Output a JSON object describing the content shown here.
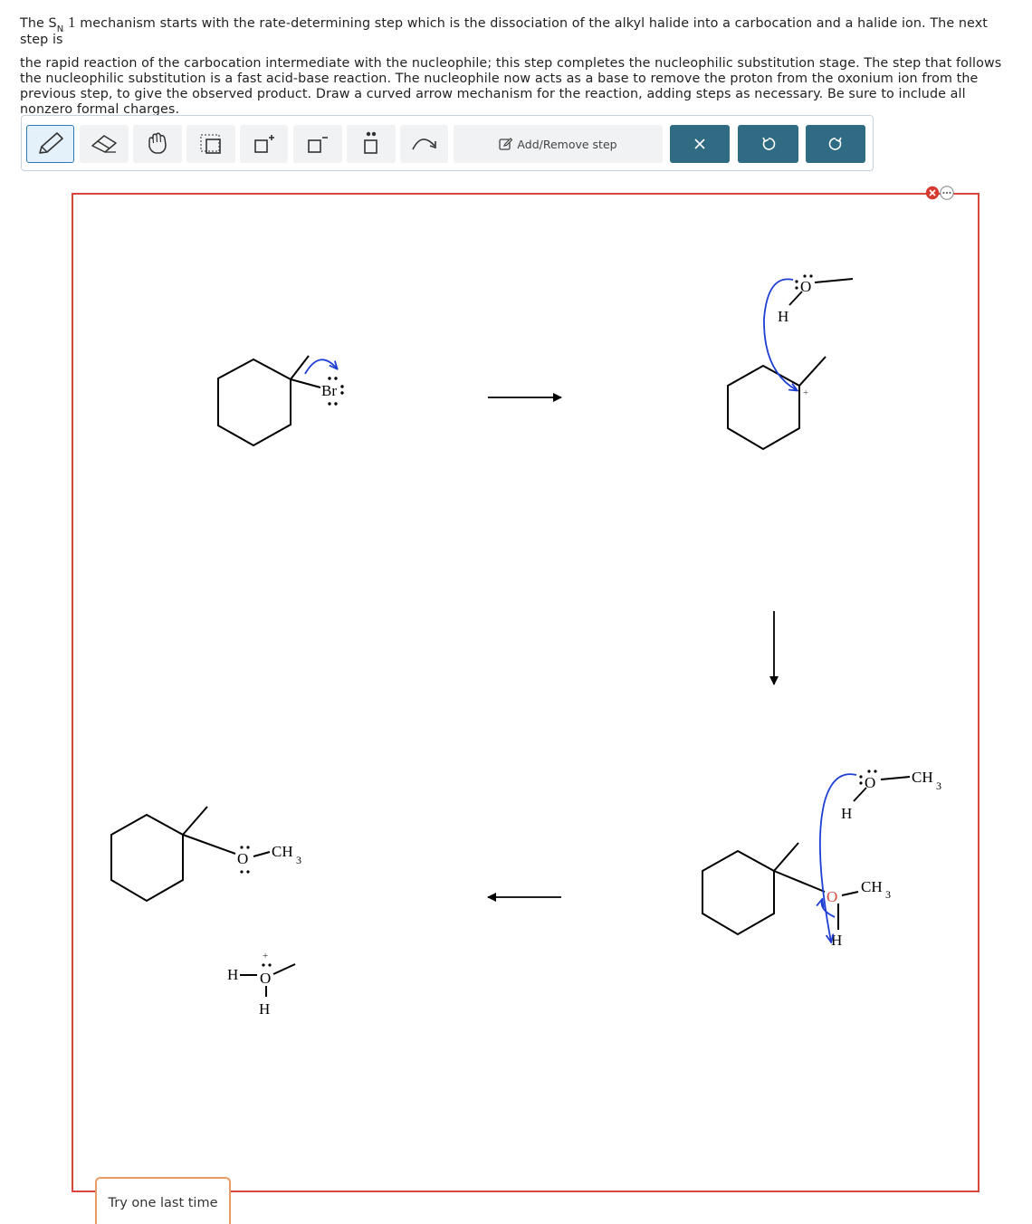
{
  "question": {
    "sn_letter": "S",
    "sn_sub": "N",
    "sn_num": "1",
    "line1_rest": "mechanism starts with the rate-determining step which is the dissociation of the alkyl halide into a carbocation and a halide ion. The next step is",
    "rest": "the rapid reaction of the carbocation intermediate with the nucleophile; this step completes the nucleophilic substitution stage. The step that follows the nucleophilic substitution is a fast acid-base reaction. The nucleophile now acts as a base to remove the proton from the oxonium ion from the previous step, to give the observed product. Draw a curved arrow mechanism for the reaction, adding steps as necessary. Be sure to include all nonzero formal charges."
  },
  "toolbar": {
    "add_remove_step": "Add/Remove step",
    "icons": [
      "pencil-icon",
      "eraser-icon",
      "hand-icon",
      "select-box-icon",
      "positive-charge-icon",
      "negative-charge-icon",
      "lone-pair-icon",
      "curved-arrow-icon",
      "pencil-small-icon",
      "close-icon",
      "undo-icon",
      "redo-icon"
    ]
  },
  "structures": {
    "br": "Br",
    "o": "O",
    "h": "H",
    "ch3_c": "CH",
    "ch3_sub": "3",
    "plus": "+"
  },
  "footer": {
    "try_button": "Try one last time"
  },
  "colors": {
    "accent_red": "#d9473a",
    "arrow_blue": "#1f3fd4",
    "tool_dark": "#2f6c83",
    "selected_border": "#2c7bb6",
    "try_border": "#e79b63"
  }
}
